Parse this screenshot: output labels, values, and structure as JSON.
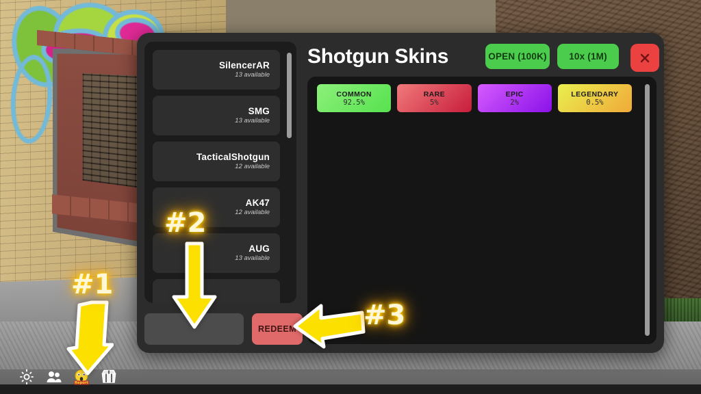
{
  "scene": {
    "description": "roblox-street-scene-graffiti-brick-wall"
  },
  "taskbar": {
    "icons": [
      {
        "name": "settings-gear-icon",
        "glyph": "gear"
      },
      {
        "name": "friends-people-icon",
        "glyph": "people"
      },
      {
        "name": "report-emoji-icon",
        "glyph": "emoji",
        "label": "Report"
      },
      {
        "name": "shop-crate-icon",
        "glyph": "shop"
      }
    ]
  },
  "modal": {
    "title": "Shotgun Skins",
    "buttons": {
      "open": "OPEN (100K)",
      "open10x": "10x (1M)",
      "close_icon": "close-x-icon"
    },
    "colors": {
      "accent_green": "#4ccc4c",
      "close_red": "#ec4141",
      "redeem_red": "#e06a6a",
      "panel_dark": "#151515",
      "modal_bg": "#2c2c2c",
      "scrollbar": "#9c9c9c"
    }
  },
  "sidebar": {
    "items": [
      {
        "name": "SilencerAR",
        "available": "13 available"
      },
      {
        "name": "SMG",
        "available": "13 available"
      },
      {
        "name": "TacticalShotgun",
        "available": "12 available"
      },
      {
        "name": "AK47",
        "available": "12 available"
      },
      {
        "name": "AUG",
        "available": "13 available"
      },
      {
        "name": "",
        "available": ""
      }
    ]
  },
  "redeem": {
    "input_value": "",
    "input_placeholder": "",
    "button_label": "REDEEM"
  },
  "rarities": [
    {
      "label": "COMMON",
      "percent": "92.5%",
      "from": "#8cf07a",
      "to": "#57e24f"
    },
    {
      "label": "RARE",
      "percent": "5%",
      "from": "#f07a7a",
      "to": "#c81d3c"
    },
    {
      "label": "EPIC",
      "percent": "2%",
      "from": "#d65bff",
      "to": "#8a12e8"
    },
    {
      "label": "LEGENDARY",
      "percent": "0.5%",
      "from": "#e9ef4e",
      "to": "#f0a93a"
    }
  ],
  "annotations": [
    {
      "label": "#1",
      "target": "shop-crate-icon",
      "direction": "down"
    },
    {
      "label": "#2",
      "target": "code-input-field",
      "direction": "down"
    },
    {
      "label": "#3",
      "target": "redeem-button",
      "direction": "left"
    }
  ]
}
